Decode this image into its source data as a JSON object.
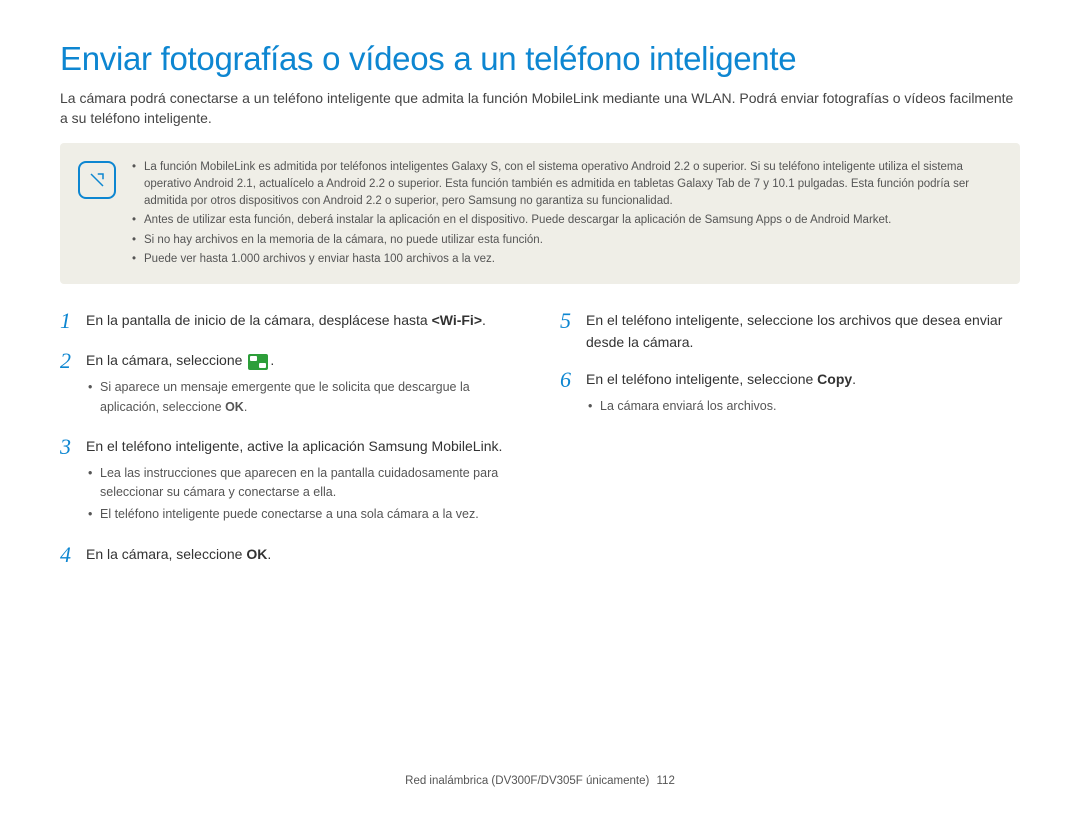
{
  "title": "Enviar fotografías o vídeos a un teléfono inteligente",
  "intro": "La cámara podrá conectarse a un teléfono inteligente que admita la función MobileLink mediante una WLAN. Podrá enviar fotografías o vídeos facilmente a su teléfono inteligente.",
  "notes": [
    "La función MobileLink es admitida por teléfonos inteligentes Galaxy S, con el sistema operativo Android 2.2 o superior. Si su teléfono inteligente utiliza el sistema operativo Android 2.1, actualícelo a Android 2.2 o superior. Esta función también es admitida en tabletas Galaxy Tab de 7 y 10.1 pulgadas. Esta función podría ser admitida por otros dispositivos con Android 2.2 o superior, pero Samsung no garantiza su funcionalidad.",
    "Antes de utilizar esta función, deberá instalar la aplicación en el dispositivo. Puede descargar la aplicación de Samsung Apps o de Android Market.",
    "Si no hay archivos en la memoria de la cámara, no puede utilizar esta función.",
    "Puede ver hasta 1.000 archivos y enviar hasta 100 archivos a la vez."
  ],
  "steps": {
    "s1": {
      "num": "1",
      "pre": "En la pantalla de inicio de la cámara, desplácese hasta ",
      "bold": "<Wi-Fi>",
      "post": "."
    },
    "s2": {
      "num": "2",
      "pre": "En la cámara, seleccione ",
      "post": ".",
      "sub": [
        "Si aparece un mensaje emergente que le solicita que descargue la aplicación, seleccione OK."
      ],
      "sub_bold_at_end": "OK"
    },
    "s3": {
      "num": "3",
      "text": "En el teléfono inteligente, active la aplicación Samsung MobileLink.",
      "sub": [
        "Lea las instrucciones que aparecen en la pantalla cuidadosamente para seleccionar su cámara y conectarse a ella.",
        "El teléfono inteligente puede conectarse a una sola cámara a la vez."
      ]
    },
    "s4": {
      "num": "4",
      "pre": "En la cámara, seleccione ",
      "bold": "OK",
      "post": "."
    },
    "s5": {
      "num": "5",
      "text": "En el teléfono inteligente, seleccione los archivos que desea enviar desde la cámara."
    },
    "s6": {
      "num": "6",
      "pre": "En el teléfono inteligente, seleccione ",
      "bold": "Copy",
      "post": ".",
      "sub": [
        "La cámara enviará los archivos."
      ]
    }
  },
  "footer": {
    "text": "Red inalámbrica (DV300F/DV305F únicamente)",
    "page": "112"
  }
}
